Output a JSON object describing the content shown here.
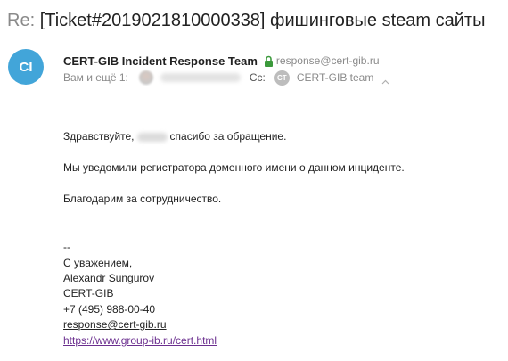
{
  "email": {
    "subject_prefix": "Re:",
    "subject": "[Ticket#2019021810000338] фишинговые steam сайты",
    "sender": {
      "avatar_initials": "CI",
      "name": "CERT-GIB Incident Response Team",
      "email": "response@cert-gib.ru"
    },
    "recipients": {
      "to_label": "Вам и ещё 1:",
      "cc_label": "Cc:",
      "cc_avatar_initials": "CT",
      "cc_name": "CERT-GIB team"
    },
    "body": {
      "greeting_before": "Здравствуйте,",
      "greeting_after": "спасибо за обращение.",
      "line2": "Мы уведомили регистратора доменного имени о данном инциденте.",
      "line3": "Благодарим за сотрудничество."
    },
    "signature": {
      "separator": "--",
      "regards": "С уважением,",
      "name": "Alexandr Sungurov",
      "org": "CERT-GIB",
      "phone": "+7 (495) 988-00-40",
      "email": "response@cert-gib.ru",
      "url": "https://www.group-ib.ru/cert.html"
    }
  },
  "colors": {
    "avatar_bg": "#42a5d9",
    "lock_green": "#3c9a3c",
    "link_visited": "#6b2f8f",
    "muted_text": "#8a8a8a"
  },
  "icons": {
    "lock": "lock-icon",
    "collapse": "chevron-up-icon"
  }
}
